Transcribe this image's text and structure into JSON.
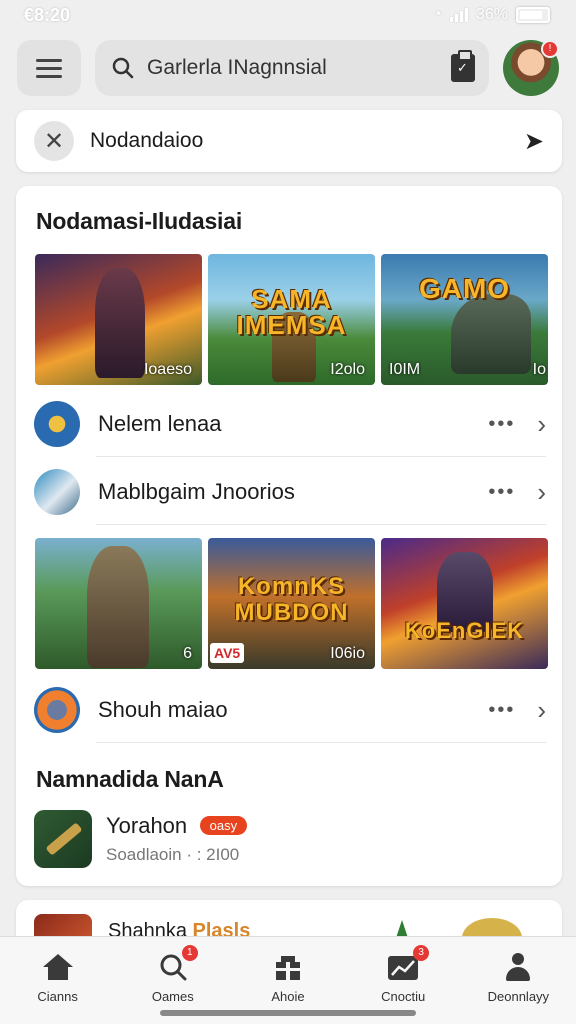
{
  "status_bar": {
    "time": "€8:20",
    "battery": "36%"
  },
  "header": {
    "search_label": "Garlerla INagnnsial"
  },
  "filter": {
    "text": "Nodandaioo"
  },
  "section1": {
    "title": "Nodamasi-Iludasiai",
    "tiles": [
      {
        "caption": "Ioaeso",
        "big_text": ""
      },
      {
        "caption": "I2olo",
        "big_text": "SAMA IMEMSA"
      },
      {
        "caption": "I0IM",
        "caption_right": "Io",
        "big_text": "GAMO"
      }
    ]
  },
  "list_rows": [
    {
      "label": "Nelem lenaa"
    },
    {
      "label": "Mablbgaim Jnoorios"
    }
  ],
  "section2_tiles": [
    {
      "caption": "6",
      "big_text": ""
    },
    {
      "caption": "I06io",
      "big_text": "KomnKS MUBDON",
      "tag": "AV5"
    },
    {
      "caption": "",
      "big_text": "KoEnGIEK"
    }
  ],
  "list_row3": {
    "label": "Shouh maiao"
  },
  "section3": {
    "title": "Namnadida NanA",
    "app": {
      "name": "Yorahon",
      "badge": "oasy",
      "sub": "Soadlaoin · : 2I00"
    }
  },
  "peek": {
    "title_main": "Shahnka",
    "title_hl": "Plasls"
  },
  "bottom_nav": [
    {
      "label": "Cianns",
      "icon": "home-icon",
      "badge": ""
    },
    {
      "label": "Oames",
      "icon": "search-icon",
      "badge": "1"
    },
    {
      "label": "Ahoie",
      "icon": "gift-icon",
      "badge": ""
    },
    {
      "label": "Cnoctiu",
      "icon": "chart-icon",
      "badge": "3"
    },
    {
      "label": "Deonnlayy",
      "icon": "person-icon",
      "badge": ""
    }
  ]
}
